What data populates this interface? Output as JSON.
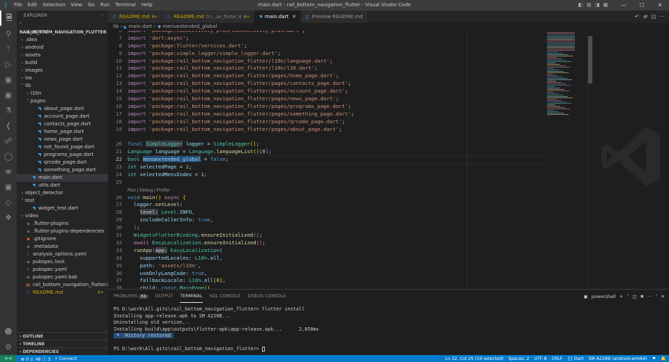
{
  "titlebar": {
    "title": "main.dart - rail_bottom_navigation_flutter - Visual Studio Code",
    "menu": [
      "File",
      "Edit",
      "Selection",
      "View",
      "Go",
      "Run",
      "Terminal",
      "Help"
    ],
    "controls": [
      "—",
      "☐",
      "✕"
    ]
  },
  "activity_bar": {
    "icons": [
      "files-icon",
      "search-icon",
      "source-control-icon",
      "run-debug-icon",
      "extensions-icon",
      "remote-explorer-icon",
      "testing-icon",
      "flutter-icon",
      "git-graph-icon",
      "github-icon",
      "database-icon",
      "docker-icon",
      "project-icon",
      "bookmark-icon",
      "account-icon",
      "settings-icon"
    ]
  },
  "sidebar": {
    "title": "EXPLORER",
    "more": "···",
    "root": "RAIL_BOTTOM_NAVIGATION_FLUTTER",
    "items": [
      {
        "label": ".dart_tool",
        "kind": "folder",
        "depth": 0,
        "open": false
      },
      {
        "label": ".idea",
        "kind": "folder",
        "depth": 0,
        "open": false
      },
      {
        "label": "android",
        "kind": "folder",
        "depth": 0,
        "open": false
      },
      {
        "label": "assets",
        "kind": "folder",
        "depth": 0,
        "open": false
      },
      {
        "label": "build",
        "kind": "folder",
        "depth": 0,
        "open": false
      },
      {
        "label": "images",
        "kind": "folder",
        "depth": 0,
        "open": false
      },
      {
        "label": "ios",
        "kind": "folder",
        "depth": 0,
        "open": false
      },
      {
        "label": "lib",
        "kind": "folder",
        "depth": 0,
        "open": true
      },
      {
        "label": "l10n",
        "kind": "folder",
        "depth": 1,
        "open": false
      },
      {
        "label": "pages",
        "kind": "folder",
        "depth": 1,
        "open": true
      },
      {
        "label": "about_page.dart",
        "kind": "dart",
        "depth": 2
      },
      {
        "label": "account_page.dart",
        "kind": "dart",
        "depth": 2
      },
      {
        "label": "contacts_page.dart",
        "kind": "dart",
        "depth": 2
      },
      {
        "label": "home_page.dart",
        "kind": "dart",
        "depth": 2
      },
      {
        "label": "news_page.dart",
        "kind": "dart",
        "depth": 2
      },
      {
        "label": "not_found_page.dart",
        "kind": "dart",
        "depth": 2
      },
      {
        "label": "programs_page.dart",
        "kind": "dart",
        "depth": 2
      },
      {
        "label": "qrcode_page.dart",
        "kind": "dart",
        "depth": 2
      },
      {
        "label": "something_page.dart",
        "kind": "dart",
        "depth": 2
      },
      {
        "label": "main.dart",
        "kind": "dart",
        "depth": 1,
        "selected": true
      },
      {
        "label": "utils.dart",
        "kind": "dart",
        "depth": 1
      },
      {
        "label": "object_detector",
        "kind": "folder",
        "depth": 0,
        "open": false
      },
      {
        "label": "test",
        "kind": "folder",
        "depth": 0,
        "open": true
      },
      {
        "label": "widget_test.dart",
        "kind": "dart",
        "depth": 1
      },
      {
        "label": "video",
        "kind": "folder",
        "depth": 0,
        "open": false
      },
      {
        "label": ".flutter-plugins",
        "kind": "file",
        "depth": 0
      },
      {
        "label": ".flutter-plugins-dependencies",
        "kind": "file",
        "depth": 0
      },
      {
        "label": ".gitignore",
        "kind": "git",
        "depth": 0
      },
      {
        "label": ".metadata",
        "kind": "file",
        "depth": 0
      },
      {
        "label": "analysis_options.yaml",
        "kind": "yaml",
        "depth": 0
      },
      {
        "label": "pubspec.lock",
        "kind": "file",
        "depth": 0
      },
      {
        "label": "pubspec.yaml",
        "kind": "yaml",
        "depth": 0
      },
      {
        "label": "pubspec.yaml.bak",
        "kind": "file",
        "depth": 0
      },
      {
        "label": "rail_bottom_navigation_flutter.iml",
        "kind": "iml",
        "depth": 0
      },
      {
        "label": "README.md",
        "kind": "md",
        "depth": 0,
        "badge": "9+"
      }
    ],
    "sections": [
      "OUTLINE",
      "TIMELINE",
      "DEPENDENCIES"
    ]
  },
  "tabs": [
    {
      "label": "README.md",
      "desc": "",
      "mod": "9+",
      "icon": "ⓘ",
      "active": false
    },
    {
      "label": "README.md",
      "desc": "D:\\...\\ar_flutter_6",
      "mod": "9+",
      "icon": "ⓘ",
      "active": false
    },
    {
      "label": "main.dart",
      "desc": "",
      "mod": "",
      "icon": "◥",
      "active": true
    },
    {
      "label": "Preview README.md",
      "desc": "",
      "mod": "",
      "icon": "◫",
      "active": false
    }
  ],
  "breadcrumb": {
    "parts": [
      "lib",
      "main.dart",
      "menuextended_global"
    ]
  },
  "code": [
    {
      "n": 6,
      "h": "<span class=\"c\">import</span> <span class=\"s\">'package:connectivity_plus/connectivity_plus.dart'</span><span class=\"p\">;</span>"
    },
    {
      "n": 7,
      "h": "<span class=\"c\">import</span> <span class=\"s\">'dart:async'</span><span class=\"p\">;</span>"
    },
    {
      "n": 8,
      "h": "<span class=\"c\">import</span> <span class=\"s\">'package:flutter/services.dart'</span><span class=\"p\">;</span>"
    },
    {
      "n": 9,
      "h": "<span class=\"c\">import</span> <span class=\"s\">'package:simple_logger/simple_logger.dart'</span><span class=\"p\">;</span>"
    },
    {
      "n": 10,
      "h": "<span class=\"c\">import</span> <span class=\"s\">'package:rail_bottom_navigation_flutter/l10n/language.dart'</span><span class=\"p\">;</span>"
    },
    {
      "n": 11,
      "h": "<span class=\"c\">import</span> <span class=\"s\">'package:rail_bottom_navigation_flutter/l10n/l10.dart'</span><span class=\"p\">;</span>"
    },
    {
      "n": 12,
      "h": "<span class=\"c\">import</span> <span class=\"s\">'package:rail_bottom_navigation_flutter/pages/home_page.dart'</span><span class=\"p\">;</span>"
    },
    {
      "n": 13,
      "h": "<span class=\"c\">import</span> <span class=\"s\">'package:rail_bottom_navigation_flutter/pages/contacts_page.dart'</span><span class=\"p\">;</span>"
    },
    {
      "n": 14,
      "h": "<span class=\"c\">import</span> <span class=\"s\">'package:rail_bottom_navigation_flutter/pages/account_page.dart'</span><span class=\"p\">;</span>"
    },
    {
      "n": 15,
      "h": "<span class=\"c\">import</span> <span class=\"s\">'package:rail_bottom_navigation_flutter/pages/news_page.dart'</span><span class=\"p\">;</span>"
    },
    {
      "n": 16,
      "h": "<span class=\"c\">import</span> <span class=\"s\">'package:rail_bottom_navigation_flutter/pages/programs_page.dart'</span><span class=\"p\">;</span>"
    },
    {
      "n": 17,
      "h": "<span class=\"c\">import</span> <span class=\"s\">'package:rail_bottom_navigation_flutter/pages/something_page.dart'</span><span class=\"p\">;</span>"
    },
    {
      "n": 18,
      "h": "<span class=\"c\">import</span> <span class=\"s\">'package:rail_bottom_navigation_flutter/pages/qrcode_page.dart'</span><span class=\"p\">;</span>"
    },
    {
      "n": 19,
      "h": "<span class=\"c\">import</span> <span class=\"s\">'package:rail_bottom_navigation_flutter/pages/about_page.dart'</span><span class=\"p\">;</span>"
    },
    {
      "n": 20,
      "h": ""
    },
    {
      "n": 20,
      "h": "<span class=\"k\">final</span> <span class=\"t hl\">SimpleLogger</span> <span class=\"v\">logger</span> <span class=\"p\">=</span> <span class=\"t\">SimpleLogger</span><span class=\"by\">()</span><span class=\"p\">;</span>"
    },
    {
      "n": 21,
      "h": "<span class=\"t\">Language</span> <span class=\"v\">language</span> <span class=\"p\">=</span> <span class=\"t\">Language</span><span class=\"p\">.</span><span class=\"f\">languageList</span><span class=\"by\">()</span><span class=\"pk\">[</span><span class=\"n\">0</span><span class=\"pk\">]</span><span class=\"p\">;</span>"
    },
    {
      "n": 22,
      "h": "<span class=\"t\">bool</span> <span class=\"v sel\">menuextended_global</span> <span class=\"p\">=</span> <span class=\"k\">false</span><span class=\"p\">;</span>",
      "cur": true
    },
    {
      "n": 23,
      "h": "<span class=\"t\">int</span> <span class=\"v\">selectedPage</span> <span class=\"p\">=</span> <span class=\"n\">1</span><span class=\"p\">;</span>"
    },
    {
      "n": 24,
      "h": "<span class=\"t\">int</span> <span class=\"v\">selectedMenuIndex</span> <span class=\"p\">=</span> <span class=\"n\">1</span><span class=\"p\">;</span>"
    },
    {
      "n": 25,
      "h": ""
    },
    {
      "n": null,
      "h": "<span class=\"lens\">Run | Debug | Profile</span>"
    },
    {
      "n": 26,
      "h": "<span class=\"k\">void</span> <span class=\"f\">main</span><span class=\"by\">()</span> <span class=\"c\">async</span> <span class=\"by\">{</span>"
    },
    {
      "n": 27,
      "h": "  <span class=\"v\">logger</span><span class=\"p\">.</span><span class=\"f\">setLevel</span><span class=\"pk\">(</span>"
    },
    {
      "n": 28,
      "h": "    <span class=\"inlay\">level:</span> <span class=\"t\">Level</span><span class=\"p\">.</span><span class=\"v\">INFO</span><span class=\"p\">,</span>"
    },
    {
      "n": 29,
      "h": "    <span class=\"v\">includeCallerInfo</span><span class=\"p\">:</span> <span class=\"k\">true</span><span class=\"p\">,</span>"
    },
    {
      "n": 30,
      "h": "  <span class=\"pk\">)</span><span class=\"p\">;</span>"
    },
    {
      "n": 31,
      "h": "  <span class=\"t\">WidgetsFlutterBinding</span><span class=\"p\">.</span><span class=\"f\">ensureInitialized</span><span class=\"pk\">()</span><span class=\"p\">;</span>"
    },
    {
      "n": 32,
      "h": "  <span class=\"c\">await</span> <span class=\"t\">EasyLocalization</span><span class=\"p\">.</span><span class=\"f\">ensureInitialized</span><span class=\"pk\">()</span><span class=\"p\">;</span>"
    },
    {
      "n": 33,
      "h": "  <span class=\"f\">runApp</span><span class=\"pk\">(</span><span class=\"inlay\">app:</span> <span class=\"t\">EasyLocalization</span><span class=\"v\">(</span>"
    },
    {
      "n": 34,
      "h": "    <span class=\"v\">supportedLocales</span><span class=\"p\">:</span> <span class=\"t\">L10n</span><span class=\"p\">.</span><span class=\"v\">all</span><span class=\"p\">,</span>"
    },
    {
      "n": 35,
      "h": "    <span class=\"v\">path</span><span class=\"p\">:</span> <span class=\"s\">'assets/l10n'</span><span class=\"p\">,</span>"
    },
    {
      "n": 36,
      "h": "    <span class=\"v\">useOnlyLangCode</span><span class=\"p\">:</span> <span class=\"k\">true</span><span class=\"p\">,</span>"
    },
    {
      "n": 37,
      "h": "    <span class=\"v\">fallbackLocale</span><span class=\"p\">:</span> <span class=\"t\">L10n</span><span class=\"p\">.</span><span class=\"v\">all</span><span class=\"by\">[</span><span class=\"n\">0</span><span class=\"by\">]</span><span class=\"p\">,</span>"
    },
    {
      "n": 38,
      "h": "    <span class=\"v\">child</span><span class=\"p\">:</span> <span class=\"k\">const</span> <span class=\"t\">MainPage</span><span class=\"by\">()</span><span class=\"p\">,</span>"
    }
  ],
  "panel": {
    "tabs": [
      {
        "label": "PROBLEMS",
        "count": "51"
      },
      {
        "label": "OUTPUT"
      },
      {
        "label": "TERMINAL",
        "active": true
      },
      {
        "label": "SQL CONSOLE"
      },
      {
        "label": "DEBUG CONSOLE"
      }
    ],
    "shell": "powershell",
    "actions": [
      "+",
      "˅",
      "◫",
      "🗑",
      "···",
      "˄",
      "✕"
    ],
    "terminal": [
      "PS D:\\work\\All.gits\\rail_bottom_navigation_flutter> flutter install",
      "Installing app-release.apk to SM A226B...",
      "Uninstalling old version...",
      "Installing build\\app\\outputs\\flutter-apk\\app-release.apk...      2,858ms"
    ],
    "history_star": "*",
    "history": "History restored",
    "prompt": "PS D:\\work\\All.gits\\rail_bottom_navigation_flutter> "
  },
  "status": {
    "remote": "><",
    "left": [
      "⊗ 0 ⚠ 48 ⓘ 3",
      "⚡ Connect"
    ],
    "right": [
      "Ln 22, Col 25 (19 selected)",
      "Spaces: 2",
      "UTF-8",
      "CRLF",
      "{} Dart",
      "SM A226B (android-arm64)",
      "⚑",
      "🔔"
    ]
  },
  "colors": {
    "accent": "#007acc",
    "activity": "#333333",
    "sidebar": "#252526",
    "editor": "#1e1e1e"
  }
}
